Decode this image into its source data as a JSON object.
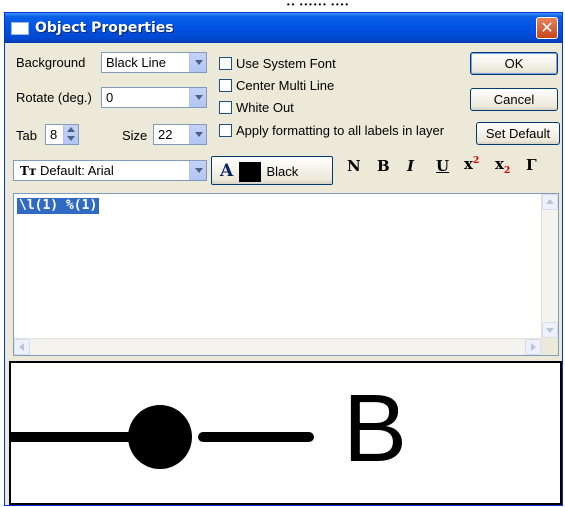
{
  "window": {
    "title": "Object Properties",
    "close_glyph": "✕",
    "title_icon": "window-icon"
  },
  "background_fragment": "·· ······ ····",
  "fields": {
    "background_label": "Background",
    "background_value": "Black Line",
    "rotate_label": "Rotate (deg.)",
    "rotate_value": "0",
    "tab_label": "Tab",
    "tab_value": "8",
    "size_label": "Size",
    "size_value": "22",
    "font_icon": "Tт",
    "font_value": "Default: Arial",
    "color_icon": "A",
    "color_value": "Black",
    "color_swatch": "#000000"
  },
  "checkboxes": [
    {
      "label": "Use System Font",
      "checked": false
    },
    {
      "label": "Center Multi Line",
      "checked": false
    },
    {
      "label": "White Out",
      "checked": false
    },
    {
      "label": "Apply formatting to all labels in layer",
      "checked": false
    }
  ],
  "buttons": {
    "ok": "OK",
    "cancel": "Cancel",
    "set_default": "Set Default"
  },
  "format_buttons": {
    "normal": "N",
    "bold": "B",
    "italic": "I",
    "underline": "U",
    "superscript_base": "x",
    "superscript_mark": "2",
    "subscript_base": "x",
    "subscript_mark": "2",
    "greek": "Γ"
  },
  "editor": {
    "text": "\\l(1) %(1)"
  },
  "preview": {
    "label_text": "B",
    "symbol": "line-circle-symbol"
  }
}
